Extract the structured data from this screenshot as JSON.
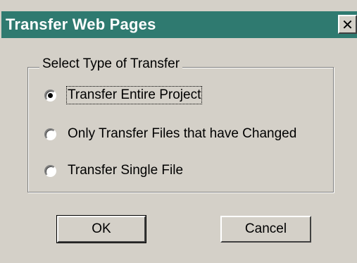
{
  "window": {
    "title": "Transfer Web Pages",
    "close_glyph": "✕",
    "title_bar_color": "#2f7a70"
  },
  "group": {
    "legend": "Select Type of Transfer",
    "options": [
      {
        "label": "Transfer Entire Project",
        "selected": true
      },
      {
        "label": "Only Transfer Files that have Changed",
        "selected": false
      },
      {
        "label": "Transfer Single File",
        "selected": false
      }
    ]
  },
  "buttons": {
    "ok_label": "OK",
    "cancel_label": "Cancel"
  }
}
